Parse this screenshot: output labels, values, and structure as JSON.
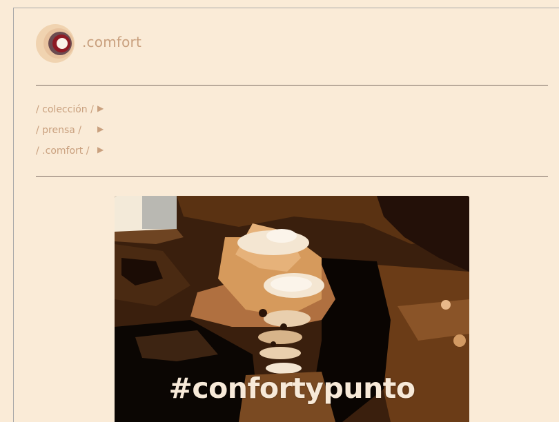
{
  "header": {
    "logo_icon": "concentric-circle-logo-icon",
    "brand": ".comfort"
  },
  "nav": {
    "items": [
      {
        "label": "/ colección /",
        "icon": "play-arrow-icon",
        "arrow": "▶"
      },
      {
        "label": "/ prensa /",
        "icon": "play-arrow-icon",
        "arrow": "▶"
      },
      {
        "label": "/ .comfort /",
        "icon": "play-arrow-icon",
        "arrow": "▶"
      }
    ]
  },
  "hero": {
    "description": "posterized photo of stacked cups and whipped cream",
    "hashtag": "#confortypunto"
  },
  "colors": {
    "background": "#faebd7",
    "accent_text": "#c9a07e",
    "rule": "#7a6a60",
    "hero_text": "#f7e9d8"
  }
}
